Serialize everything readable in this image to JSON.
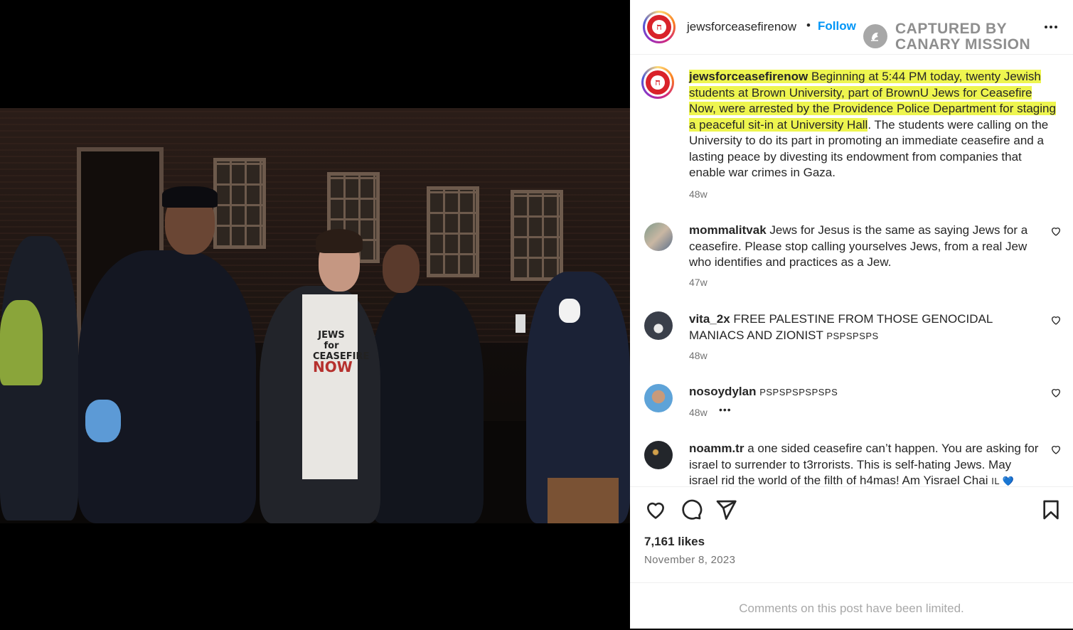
{
  "header": {
    "username": "jewsforceasefirenow",
    "separator": "•",
    "follow_label": "Follow",
    "watermark_line1": "CAPTURED BY",
    "watermark_line2": "CANARY MISSION",
    "more_icon": "more-horizontal-icon"
  },
  "caption": {
    "username": "jewsforceasefirenow",
    "highlighted_text": "Beginning at 5:44 PM today, twenty Jewish students at Brown University, part of BrownU Jews for Ceasefire Now, were arrested by the Providence Police Department for staging a peaceful sit-in at University Hall",
    "rest_text": ". The students were calling on the University to do its part in promoting an immediate ceasefire and a lasting peace by divesting its endowment from companies that enable war crimes in Gaza.",
    "time": "48w",
    "highlight_color": "#eef54f"
  },
  "comments": [
    {
      "username": "mommalitvak",
      "text": "Jews for Jesus is the same as saying Jews for a ceasefire. Please stop calling yourselves Jews, from a real Jew who identifies and practices as a Jew.",
      "time": "47w"
    },
    {
      "username": "vita_2x",
      "text": "FREE PALESTINE FROM THOSE GENOCIDAL MANIACS AND ZIONIST",
      "suffix": "PSPSPSPS",
      "time": "48w"
    },
    {
      "username": "nosoydylan",
      "text": "",
      "suffix": "PSPSPSPSPSPS",
      "time": "48w",
      "more": "•••"
    },
    {
      "username": "noamm.tr",
      "text": "a one sided ceasefire can’t happen. You are asking for israel to surrender to t3rrorists. This is self-hating Jews. May israel rid the world of the filth of h4mas! Am Yisrael Chai",
      "suffix": "IL 💙"
    }
  ],
  "actions": {
    "like_icon": "heart-icon",
    "comment_icon": "comment-icon",
    "share_icon": "share-icon",
    "save_icon": "bookmark-icon",
    "likes": "7,161 likes",
    "date": "November 8, 2023"
  },
  "footer": {
    "limited_text": "Comments on this post have been limited."
  },
  "colors": {
    "link_blue": "#0095f6",
    "brand_red": "#d9222a",
    "muted": "#737373"
  }
}
